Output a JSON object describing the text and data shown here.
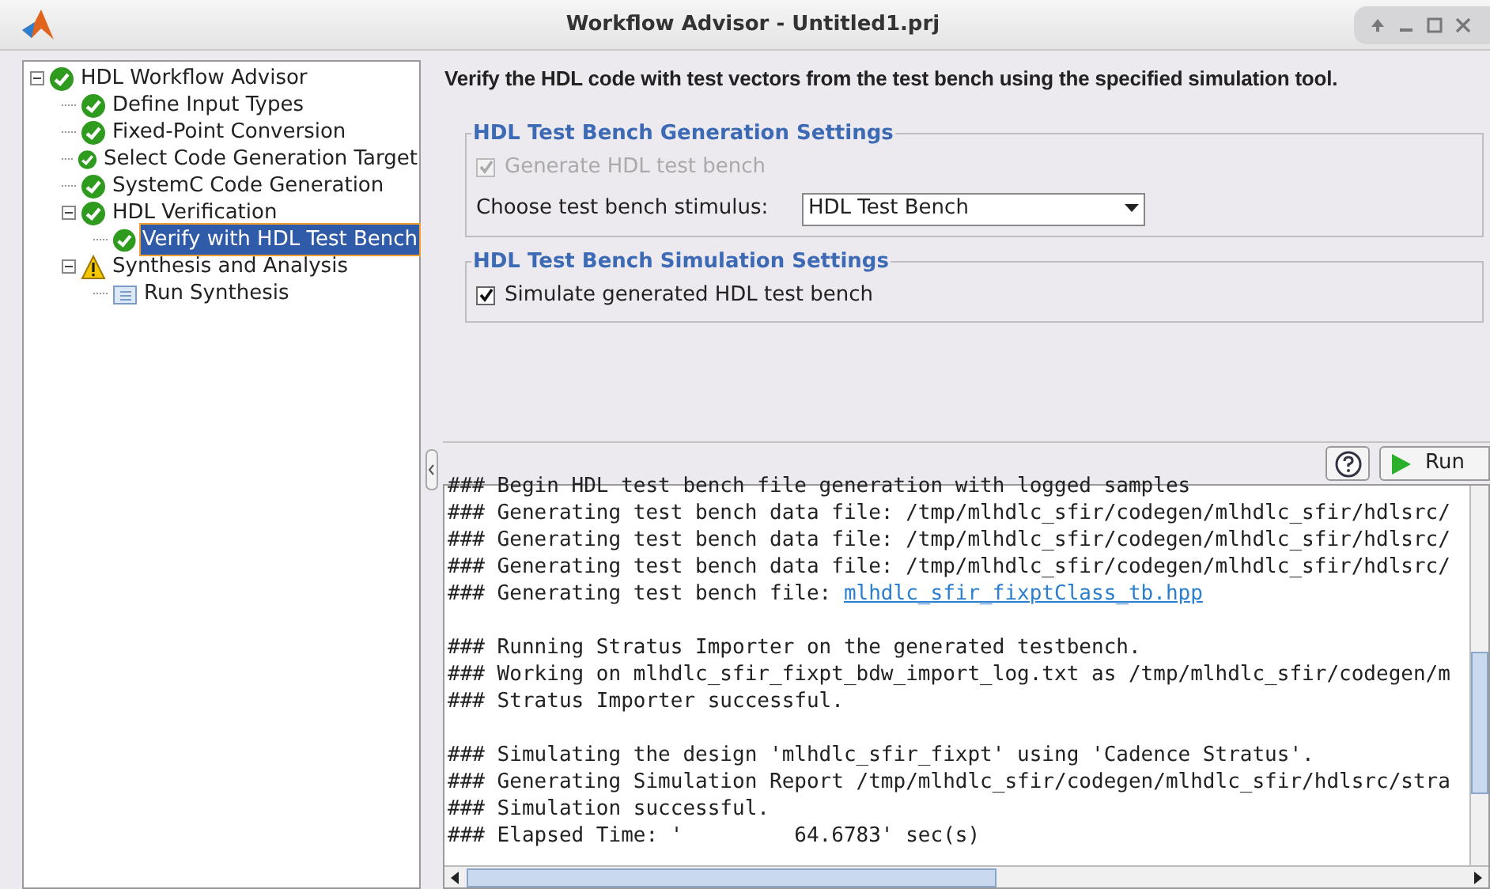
{
  "window": {
    "title": "Workflow Advisor - Untitled1.prj"
  },
  "tree": [
    {
      "label": "HDL Workflow Advisor",
      "kind": "passed",
      "expanded": true,
      "selected": false,
      "children": [
        {
          "label": "Define Input Types",
          "kind": "passed",
          "selected": false
        },
        {
          "label": "Fixed-Point Conversion",
          "kind": "passed",
          "selected": false
        },
        {
          "label": "Select Code Generation Target",
          "kind": "passed",
          "selected": false
        },
        {
          "label": "SystemC Code Generation",
          "kind": "passed",
          "selected": false
        },
        {
          "label": "HDL Verification",
          "kind": "passed",
          "expanded": true,
          "selected": false,
          "children": [
            {
              "label": "Verify with HDL Test Bench",
              "kind": "passed",
              "selected": true
            }
          ]
        },
        {
          "label": "Synthesis and Analysis",
          "kind": "warning",
          "expanded": true,
          "selected": false,
          "children": [
            {
              "label": "Run Synthesis",
              "kind": "task",
              "selected": false
            }
          ]
        }
      ]
    }
  ],
  "heading": "Verify the HDL code with test vectors from the test bench using the specified simulation tool.",
  "groups": [
    {
      "title": "HDL Test Bench Generation Settings",
      "items": [
        {
          "kind": "checkbox",
          "label": "Generate HDL test bench",
          "checked": true,
          "disabled": true
        },
        {
          "kind": "dropdown",
          "label": "Choose test bench stimulus:",
          "value": "HDL Test Bench"
        }
      ]
    },
    {
      "title": "HDL Test Bench Simulation Settings",
      "items": [
        {
          "kind": "checkbox",
          "label": "Simulate generated HDL test bench",
          "checked": true,
          "disabled": false
        }
      ]
    }
  ],
  "run_button": "Run",
  "log": [
    [
      {
        "text": "### Begin HDL test bench file generation with logged samples"
      },
      {
        "text": "### Generating test bench data file: /tmp/mlhdlc_sfir/codegen/mlhdlc_sfir/hdlsrc/"
      },
      {
        "text": "### Generating test bench data file: /tmp/mlhdlc_sfir/codegen/mlhdlc_sfir/hdlsrc/"
      },
      {
        "text": "### Generating test bench data file: /tmp/mlhdlc_sfir/codegen/mlhdlc_sfir/hdlsrc/"
      },
      {
        "text": "### Generating test bench file: ",
        "link": "mlhdlc_sfir_fixptClass_tb.hpp"
      }
    ],
    [
      {
        "text": "### Running Stratus Importer on the generated testbench."
      },
      {
        "text": "### Working on mlhdlc_sfir_fixpt_bdw_import_log.txt as /tmp/mlhdlc_sfir/codegen/m"
      },
      {
        "text": "### Stratus Importer successful."
      }
    ],
    [
      {
        "text": "### Simulating the design 'mlhdlc_sfir_fixpt' using 'Cadence Stratus'."
      },
      {
        "text": "### Generating Simulation Report /tmp/mlhdlc_sfir/codegen/mlhdlc_sfir/hdlsrc/stra"
      },
      {
        "text": "### Simulation successful."
      },
      {
        "text": "### Elapsed Time: '         64.6783' sec(s)"
      }
    ]
  ]
}
